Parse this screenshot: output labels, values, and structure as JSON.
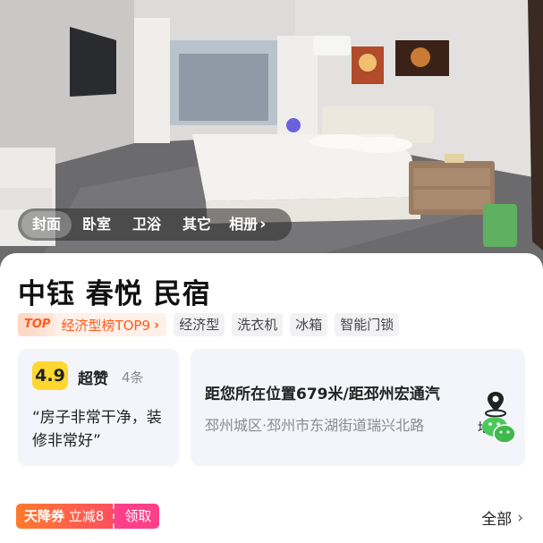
{
  "gallery": {
    "tabs": [
      {
        "label": "封面",
        "active": true
      },
      {
        "label": "卧室",
        "active": false
      },
      {
        "label": "卫浴",
        "active": false
      },
      {
        "label": "其它",
        "active": false
      }
    ],
    "album_label": "相册"
  },
  "hotel": {
    "name": "中钰 春悦 民宿",
    "rank": {
      "badge": "TOP",
      "text": "经济型榜TOP9"
    },
    "tags": [
      "经济型",
      "洗衣机",
      "冰箱",
      "智能门锁"
    ]
  },
  "rating": {
    "score": "4.9",
    "label": "超赞",
    "count": "4条",
    "quote": "“房子非常干净，装修非常好”"
  },
  "location": {
    "distance": "距您所在位置679米/距邳州宏通汽",
    "address": "邳州城区·邳州市东湖街道瑞兴北路",
    "map_label": "地图"
  },
  "coupon": {
    "name": "天降券",
    "discount": "立减8",
    "claim": "领取"
  },
  "see_all": "全部",
  "colors": {
    "accent": "#ff5a1f",
    "score_bg": "#ffd72e",
    "coupon_start": "#ff7a2c",
    "coupon_claim": "#ff3f8a"
  }
}
